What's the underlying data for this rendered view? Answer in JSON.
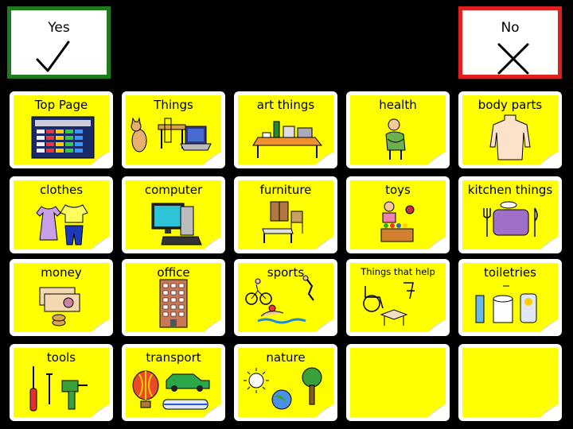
{
  "yes_button": {
    "label": "Yes",
    "icon": "check-icon",
    "border_color": "#1e7b1e"
  },
  "no_button": {
    "label": "No",
    "icon": "cross-icon",
    "border_color": "#e02020"
  },
  "tile_color": "#ffff00",
  "tiles": [
    {
      "label": "Top Page",
      "icon": "grid-board-icon"
    },
    {
      "label": "Things",
      "icon": "cat-table-laptop-icon"
    },
    {
      "label": "art things",
      "icon": "art-table-icon"
    },
    {
      "label": "health",
      "icon": "sick-person-icon"
    },
    {
      "label": "body parts",
      "icon": "torso-icon"
    },
    {
      "label": "clothes",
      "icon": "clothes-icon"
    },
    {
      "label": "computer",
      "icon": "desktop-computer-icon"
    },
    {
      "label": "furniture",
      "icon": "furniture-icon"
    },
    {
      "label": "toys",
      "icon": "toys-icon"
    },
    {
      "label": "kitchen things",
      "icon": "place-setting-icon"
    },
    {
      "label": "money",
      "icon": "money-icon"
    },
    {
      "label": "office",
      "icon": "office-building-icon"
    },
    {
      "label": "sports",
      "icon": "sports-icon"
    },
    {
      "label": "Things that help",
      "icon": "wheelchair-aids-icon"
    },
    {
      "label": "toiletries",
      "icon": "toiletries-icon"
    },
    {
      "label": "tools",
      "icon": "tools-icon"
    },
    {
      "label": "transport",
      "icon": "transport-icon"
    },
    {
      "label": "nature",
      "icon": "nature-icon"
    },
    {
      "label": "",
      "icon": ""
    },
    {
      "label": "",
      "icon": ""
    }
  ]
}
